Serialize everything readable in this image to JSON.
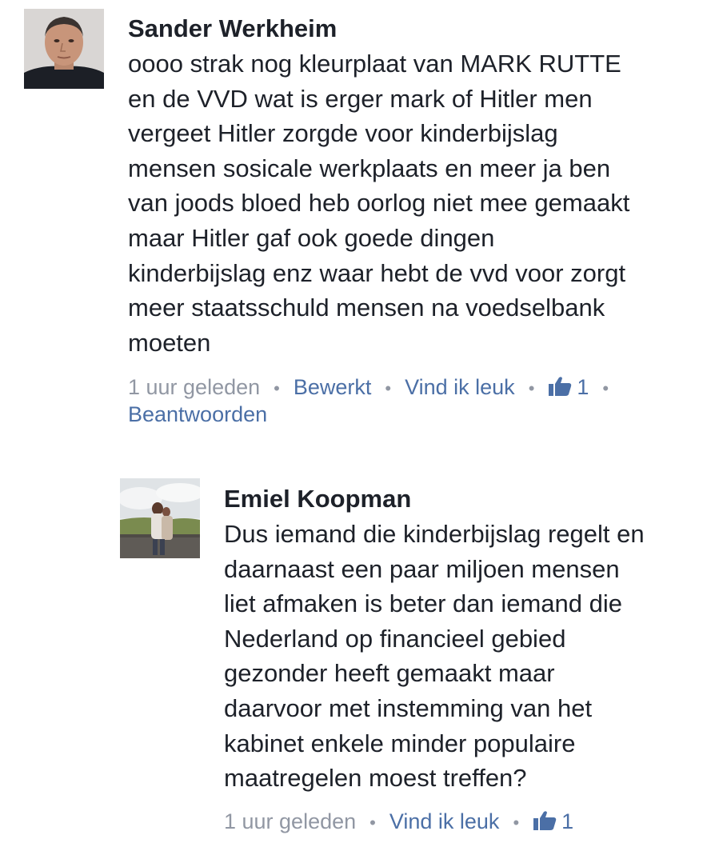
{
  "comments": [
    {
      "author": "Sander Werkheim",
      "lines": [
        "oooo strak nog kleurplaat van MARK RUTTE",
        "en de VVD wat is erger mark of Hitler men",
        "vergeet Hitler zorgde voor kinderbijslag",
        "mensen sosicale werkplaats en meer ja ben",
        "van joods bloed heb oorlog niet mee gemaakt",
        "maar Hitler gaf ook goede dingen",
        "kinderbijslag enz waar hebt de vvd voor zorgt",
        "meer staatsschuld mensen na voedselbank",
        "moeten"
      ],
      "time": "1 uur geleden",
      "edited": "Bewerkt",
      "like_label": "Vind ik leuk",
      "like_count": "1",
      "reply_label": "Beantwoorden",
      "like_icon": "thumbs-up-icon"
    },
    {
      "author": "Emiel Koopman",
      "lines": [
        "Dus iemand die kinderbijslag regelt en",
        "daarnaast een paar miljoen mensen",
        "liet afmaken is beter dan iemand die",
        "Nederland op financieel gebied",
        "gezonder heeft gemaakt maar",
        "daarvoor met instemming van het",
        "kabinet enkele minder populaire",
        "maatregelen moest treffen?"
      ],
      "time": "1 uur geleden",
      "like_label": "Vind ik leuk",
      "like_count": "1",
      "like_icon": "thumbs-up-icon"
    }
  ],
  "separator": "•",
  "colors": {
    "text": "#1d2129",
    "meta": "#9197a3",
    "link": "#4b6fa6"
  }
}
